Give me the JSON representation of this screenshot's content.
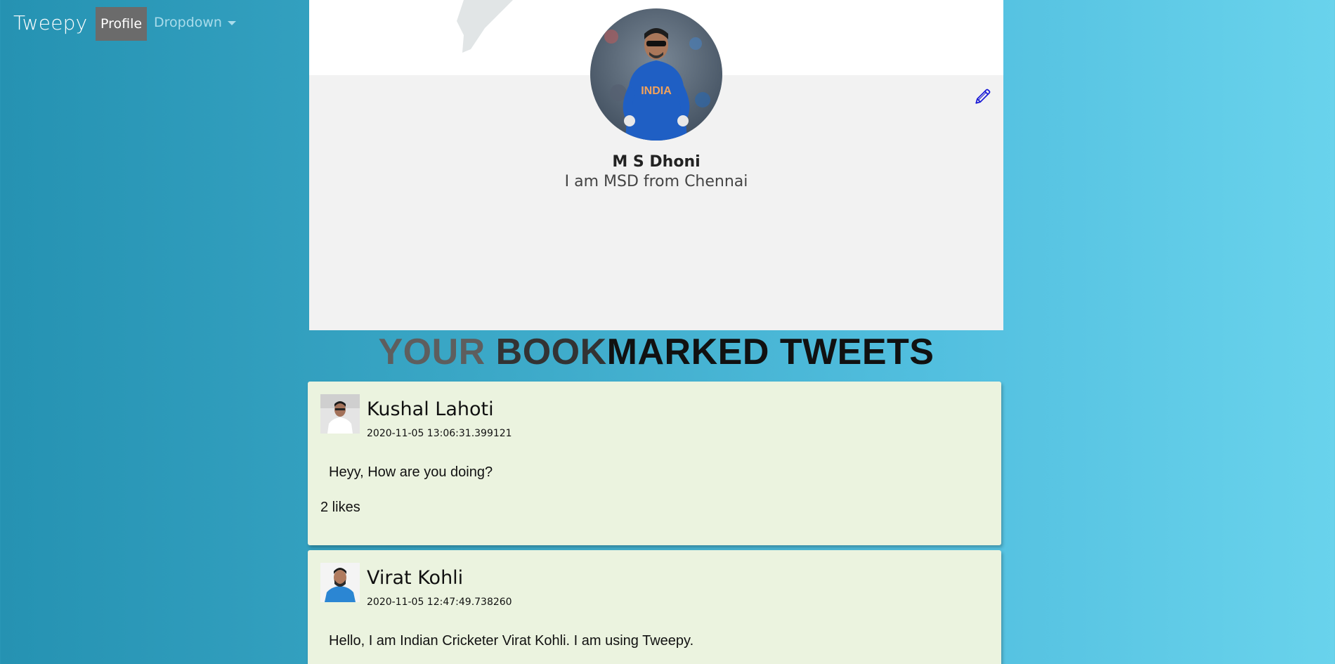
{
  "navbar": {
    "brand": "Tweepy",
    "profile_label": "Profile",
    "dropdown_label": "Dropdown"
  },
  "profile": {
    "name": "M S Dhoni",
    "bio": "I am MSD from Chennai",
    "avatar_icon": "profile-photo",
    "edit_icon": "pencil-icon"
  },
  "heading": {
    "part1": "YOUR ",
    "part2": "BOOK",
    "part3": "MARKED TWEETS"
  },
  "tweets": [
    {
      "author": "Kushal Lahoti",
      "timestamp": "2020-11-05 13:06:31.399121",
      "text": "Heyy, How are you doing?",
      "likes": "2 likes"
    },
    {
      "author": "Virat Kohli",
      "timestamp": "2020-11-05 12:47:49.738260",
      "text": "Hello, I am Indian Cricketer Virat Kohli. I am using Tweepy."
    }
  ],
  "colors": {
    "background_start": "#2592b2",
    "background_end": "#69d3ec",
    "card": "#ebf3df",
    "profile_card": "#f2f2f2",
    "nav_active": "#6b6b6b",
    "edit_icon": "#1a1ad6"
  }
}
